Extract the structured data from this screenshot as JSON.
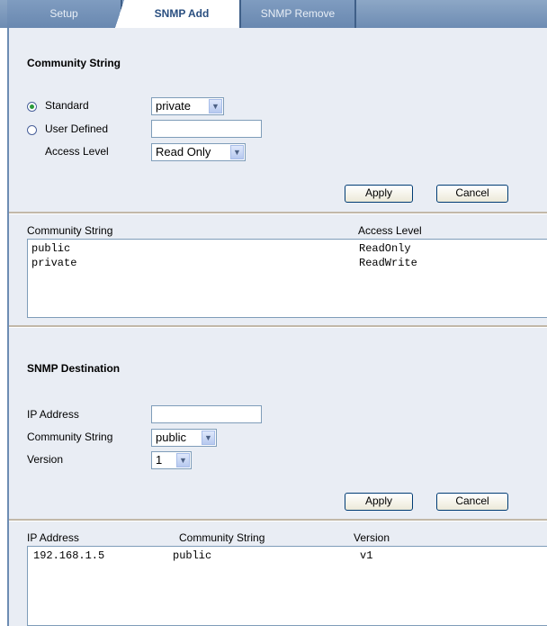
{
  "tabs": [
    {
      "label": "Setup",
      "active": false
    },
    {
      "label": "SNMP Add",
      "active": true
    },
    {
      "label": "SNMP Remove",
      "active": false
    }
  ],
  "community": {
    "section_title": "Community String",
    "standard_label": "Standard",
    "standard_selected": true,
    "standard_value": "private",
    "user_defined_label": "User Defined",
    "user_defined_value": "",
    "access_level_label": "Access Level",
    "access_level_value": "Read Only",
    "apply_label": "Apply",
    "cancel_label": "Cancel",
    "list": {
      "columns": [
        "Community String",
        "Access Level"
      ],
      "rows": [
        [
          "public",
          "ReadOnly"
        ],
        [
          "private",
          "ReadWrite"
        ]
      ]
    }
  },
  "destination": {
    "section_title": "SNMP Destination",
    "ip_label": "IP Address",
    "ip_value": "",
    "community_label": "Community String",
    "community_value": "public",
    "version_label": "Version",
    "version_value": "1",
    "apply_label": "Apply",
    "cancel_label": "Cancel",
    "list": {
      "columns": [
        "IP Address",
        "Community String",
        "Version"
      ],
      "rows": [
        [
          "192.168.1.5",
          "public",
          "v1"
        ]
      ]
    }
  },
  "colors": {
    "tabbar": "#6d8cb3",
    "active_tab_text": "#2a4f80",
    "panel_bg": "#e9edf4",
    "radio_dot": "#2a9a3a"
  }
}
